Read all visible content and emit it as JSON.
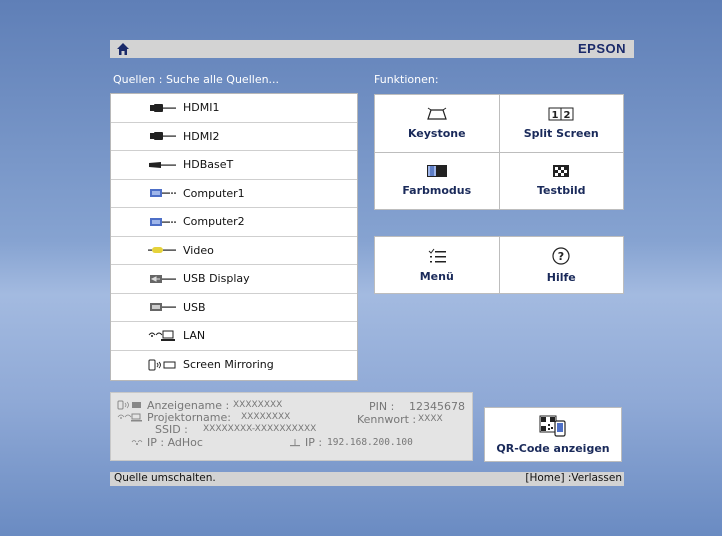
{
  "header": {
    "brand": "EPSON",
    "home_icon": "home-icon"
  },
  "sources": {
    "title": "Quellen : Suche alle Quellen...",
    "items": [
      {
        "label": "HDMI1",
        "icon": "hdmi-icon"
      },
      {
        "label": "HDMI2",
        "icon": "hdmi-icon"
      },
      {
        "label": "HDBaseT",
        "icon": "hdbaset-icon"
      },
      {
        "label": "Computer1",
        "icon": "vga-icon"
      },
      {
        "label": "Computer2",
        "icon": "vga-icon"
      },
      {
        "label": "Video",
        "icon": "video-icon"
      },
      {
        "label": "USB Display",
        "icon": "usb-display-icon"
      },
      {
        "label": "USB",
        "icon": "usb-icon"
      },
      {
        "label": "LAN",
        "icon": "lan-icon"
      },
      {
        "label": "Screen Mirroring",
        "icon": "screen-mirroring-icon"
      }
    ]
  },
  "functions": {
    "title": "Funktionen:",
    "keystone": "Keystone",
    "split_screen": "Split Screen",
    "color_mode": "Farbmodus",
    "test_pattern": "Testbild",
    "menu": "Menü",
    "help": "Hilfe"
  },
  "info": {
    "display_name_label": "Anzeigename :",
    "display_name_value": "XXXXXXXX",
    "projector_name_label": "Projektorname:",
    "projector_name_value": "XXXXXXXX",
    "ssid_label": "SSID :",
    "ssid_value": "XXXXXXXX-XXXXXXXXXX",
    "ip_adhoc_label": "IP : AdHoc",
    "ip_label": "IP :",
    "ip_value": "192.168.200.100",
    "pin_label": "PIN :",
    "pin_value": "12345678",
    "password_label": "Kennwort :",
    "password_value": "XXXX"
  },
  "qr": {
    "label": "QR-Code anzeigen"
  },
  "status": {
    "left": "Quelle umschalten.",
    "right": "[Home] :Verlassen"
  }
}
